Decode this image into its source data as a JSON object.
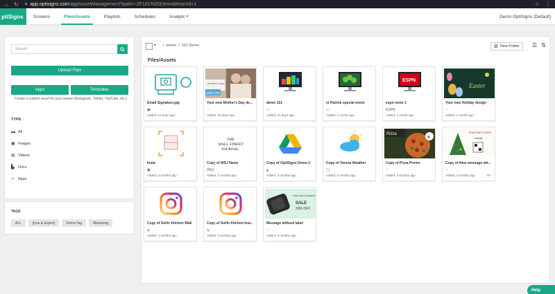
{
  "browser": {
    "url_host": "app.optisigns.com",
    "url_path": "/app/assetManagement?path=-2F101%20Demo&teamId=1"
  },
  "header": {
    "brand": "ptiSigns",
    "menu": [
      {
        "label": "Screens",
        "active": false
      },
      {
        "label": "Files/Assets",
        "active": true
      },
      {
        "label": "Playlists",
        "active": false
      },
      {
        "label": "Schedules",
        "active": false
      },
      {
        "label": "Analytic",
        "active": false
      }
    ],
    "analytic_arrow": "▾",
    "account": "Demo OptiSigns (Default)"
  },
  "sidebar": {
    "search_placeholder": "Search",
    "upload_label": "Upload Files",
    "apps_label": "Apps",
    "templates_label": "Templates",
    "custom_text": "Create a custom asset for your screen (Instagram, Twitter, YouTube, etc.)",
    "type_heading": "TYPE",
    "types": [
      {
        "label": "All",
        "icon": "list-icon",
        "glyph": "▬"
      },
      {
        "label": "Images",
        "icon": "image-icon",
        "glyph": "▣"
      },
      {
        "label": "Videos",
        "icon": "video-icon",
        "glyph": "▤"
      },
      {
        "label": "Docs",
        "icon": "doc-icon",
        "glyph": "▙"
      },
      {
        "label": "Apps",
        "icon": "rocket-icon",
        "glyph": "➶"
      }
    ],
    "tags_heading": "TAGS",
    "tags": [
      "ALL",
      "[Live & Expire]",
      "Demo-Tag",
      "Marketing"
    ]
  },
  "main": {
    "breadcrumb": [
      "Home",
      "/",
      "101 Demo"
    ],
    "breadcrumb_sep": "/",
    "new_folder": "New Folder",
    "section_title": "Files/Assets",
    "cards": [
      {
        "name": "Email Signature.jpg",
        "type_icon": "▣",
        "added": "Added: 19 days ago",
        "thumb": "email",
        "extra": ""
      },
      {
        "name": "Your new Mother's Day de...",
        "type_icon": "◔",
        "added": "Added: 19 days ago",
        "thumb": "mothers",
        "extra": ""
      },
      {
        "name": "demo 101",
        "type_icon": "▭",
        "added": "Added: 21 days ago",
        "thumb": "demo",
        "extra": ""
      },
      {
        "name": "st Patrick special event",
        "type_icon": "▭",
        "added": "Added: 1 month ago",
        "thumb": "patrick",
        "extra": ""
      },
      {
        "name": "espn news 1",
        "type_icon": "ESPN",
        "added": "Added: 1 month ago",
        "thumb": "espn",
        "extra": ""
      },
      {
        "name": "Your new Holiday design",
        "type_icon": "◔",
        "added": "Added: 1 month ago",
        "thumb": "easter",
        "extra": ""
      },
      {
        "name": "Insta",
        "type_icon": "▣",
        "added": "Added: 3 months ago",
        "thumb": "insta-frame",
        "extra": ""
      },
      {
        "name": "Copy of WSJ News",
        "type_icon": "WSJ",
        "added": "Added: 3 months ago",
        "thumb": "wsj",
        "extra": ""
      },
      {
        "name": "Copy of OptiSigns Demo 2",
        "type_icon": "◭",
        "added": "Added: 3 months ago",
        "thumb": "gdrive",
        "extra": ""
      },
      {
        "name": "Copy of Vienna Weather",
        "type_icon": "◯",
        "added": "Added: 3 months ago",
        "thumb": "weather",
        "extra": ""
      },
      {
        "name": "Copy of Pizza Promo",
        "type_icon": "◔",
        "added": "Added: 3 months ago",
        "thumb": "pizza",
        "extra": ""
      },
      {
        "name": "Copy of New message wit...",
        "type_icon": "◔",
        "added": "Added: 3 months ago",
        "thumb": "xmas",
        "extra": "⊘◔"
      },
      {
        "name": "Copy of SoHo Kitchen Wall",
        "type_icon": "◎",
        "added": "Added: 3 months ago",
        "thumb": "instagram",
        "extra": ""
      },
      {
        "name": "Copy of SoHo Kitchen Inst...",
        "type_icon": "◎",
        "added": "Added: 3 months ago",
        "thumb": "instagram",
        "extra": ""
      },
      {
        "name": "Message without label",
        "type_icon": "◔",
        "added": "Added: 3 months ago",
        "thumb": "sale",
        "extra": ""
      }
    ],
    "thumb_texts": {
      "mothers_top": "Mother's Day",
      "mothers_sale": "20% OFF",
      "easter": "Easter",
      "espn": "ESPN",
      "wsj": "THE WALL STREET JOURNAL",
      "pizza": "Pizza",
      "xmas_head": "Important notice",
      "xmas_sub": "ndsdsi",
      "sale_a": "APPLE WATCH SERIES 6",
      "sale_b": "SALE",
      "sale_c": "30% OFF"
    }
  },
  "help_label": "Help",
  "colors": {
    "accent": "#1aa886"
  }
}
